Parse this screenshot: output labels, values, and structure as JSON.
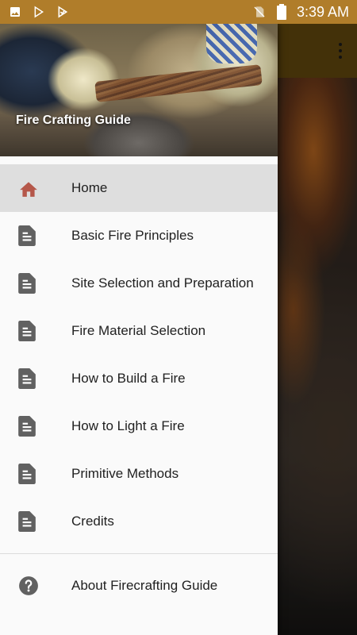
{
  "status_bar": {
    "time": "3:39 AM",
    "left_icons": [
      "image-icon",
      "play-store-icon",
      "download-check-icon"
    ],
    "right_icons": [
      "no-sim-icon",
      "battery-icon"
    ]
  },
  "app": {
    "toolbar_color": "#7a5a12",
    "overflow_icon": "more-vert-icon"
  },
  "drawer": {
    "header_title": "Fire Crafting Guide",
    "accent_color": "#b5574a",
    "items": [
      {
        "label": "Home",
        "icon": "home-icon",
        "active": true
      },
      {
        "label": "Basic Fire Principles",
        "icon": "document-icon"
      },
      {
        "label": "Site Selection and Preparation",
        "icon": "document-icon"
      },
      {
        "label": "Fire Material Selection",
        "icon": "document-icon"
      },
      {
        "label": "How to Build a Fire",
        "icon": "document-icon"
      },
      {
        "label": "How to Light a Fire",
        "icon": "document-icon"
      },
      {
        "label": "Primitive Methods",
        "icon": "document-icon"
      },
      {
        "label": "Credits",
        "icon": "document-icon"
      }
    ],
    "footer_item": {
      "label": "About Firecrafting Guide",
      "icon": "help-circle-icon"
    }
  }
}
